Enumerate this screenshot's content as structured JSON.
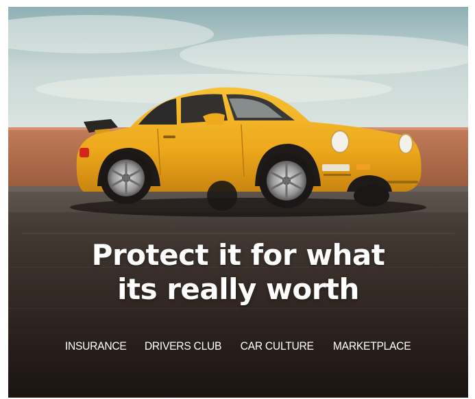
{
  "hero": {
    "image_description": "yellow-sports-car-photo",
    "headline_line1": "Protect it for what",
    "headline_line2": "its really worth"
  },
  "nav": {
    "items": [
      {
        "label": "INSURANCE"
      },
      {
        "label": "DRIVERS CLUB"
      },
      {
        "label": "CAR CULTURE"
      },
      {
        "label": "MARKETPLACE"
      }
    ]
  },
  "colors": {
    "car_yellow": "#f2b01e",
    "sky": "#bcd0d4",
    "wall": "#b0694a",
    "asphalt": "#2b2420",
    "text": "#ffffff"
  }
}
